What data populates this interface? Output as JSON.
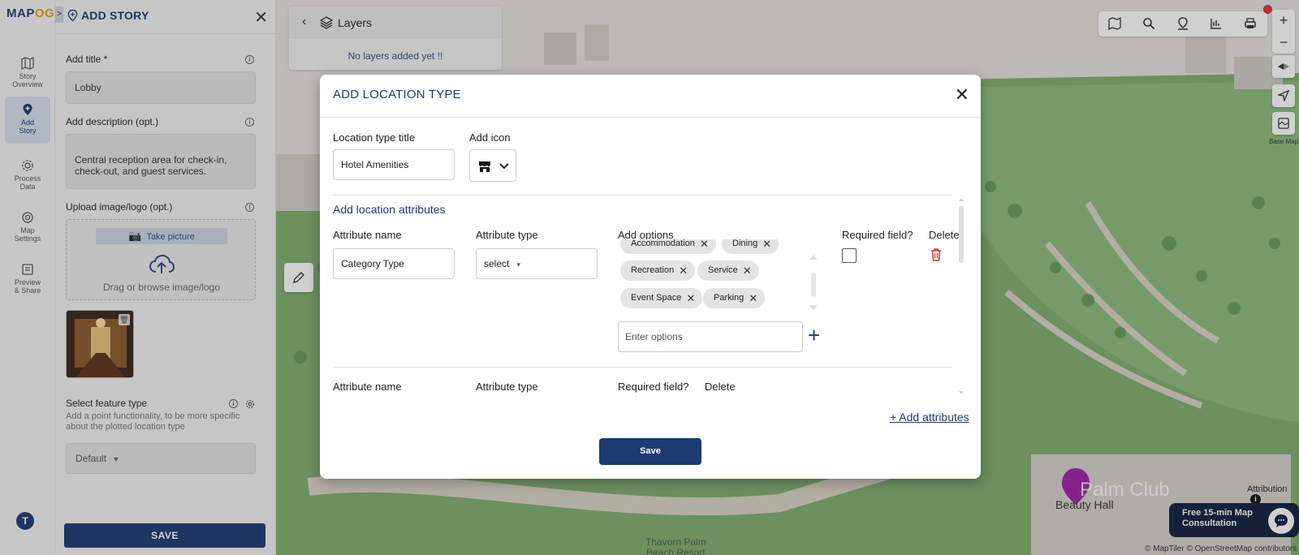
{
  "app": {
    "logo_main": "MAP",
    "logo_accent": "OG"
  },
  "rail": {
    "items": [
      {
        "label1": "Story",
        "label2": "Overview",
        "icon": "map-icon"
      },
      {
        "label1": "Add",
        "label2": "Story",
        "icon": "pin-icon"
      },
      {
        "label1": "Process",
        "label2": "Data",
        "icon": "gear-icon"
      },
      {
        "label1": "Map",
        "label2": "Settings",
        "icon": "settings-icon"
      },
      {
        "label1": "Preview",
        "label2": "& Share",
        "icon": "preview-icon"
      }
    ],
    "avatar": "T"
  },
  "panel": {
    "expand": ">",
    "title": "ADD STORY",
    "close": "✕",
    "title_label": "Add title *",
    "title_value": "Lobby",
    "desc_label": "Add description (opt.)",
    "desc_value": "Central reception area for check-in, check-out, and guest services.",
    "upload_label": "Upload image/logo (opt.)",
    "take_picture": "Take picture",
    "drag_text": "Drag or browse image/logo",
    "feature_label": "Select feature type",
    "feature_help": "Add a point functionality, to be more specific about the plotted location type",
    "feature_value": "Default",
    "save": "SAVE"
  },
  "layers": {
    "title": "Layers",
    "empty": "No layers added yet !!"
  },
  "map": {
    "base_map_label": "Base Map",
    "attribution": "Attribution",
    "consult_line1": "Free 15-min Map",
    "consult_line2": "Consultation",
    "copyright": "© MapTiler © OpenStreetMap contributors",
    "place_label": "Beauty Hall",
    "club_label": "Palm Club",
    "resort_line1": "Thavorn Palm",
    "resort_line2": "Beach Resort",
    "zoom_in": "+",
    "zoom_out": "−"
  },
  "modal": {
    "title": "ADD LOCATION TYPE",
    "close": "✕",
    "type_title_label": "Location type title",
    "type_title_value": "Hotel Amenities",
    "add_icon_label": "Add icon",
    "attributes_heading": "Add location attributes",
    "attr1": {
      "name_label": "Attribute name",
      "name_value": "Category Type",
      "type_label": "Attribute type",
      "type_value": "select",
      "options_label": "Add options",
      "options": [
        "Accommodation",
        "Dining",
        "Recreation",
        "Service",
        "Event Space",
        "Parking"
      ],
      "options_placeholder": "Enter options",
      "required_label": "Required field?",
      "delete_label": "Delete"
    },
    "attr2": {
      "name_label": "Attribute name",
      "type_label": "Attribute type",
      "required_label": "Required field?",
      "delete_label": "Delete"
    },
    "add_attributes": "+ Add attributes",
    "save": "Save"
  },
  "colors": {
    "brand": "#1c3b73",
    "accent": "#e0a400",
    "delete": "#d0342c",
    "marker": "#a11fa8"
  }
}
